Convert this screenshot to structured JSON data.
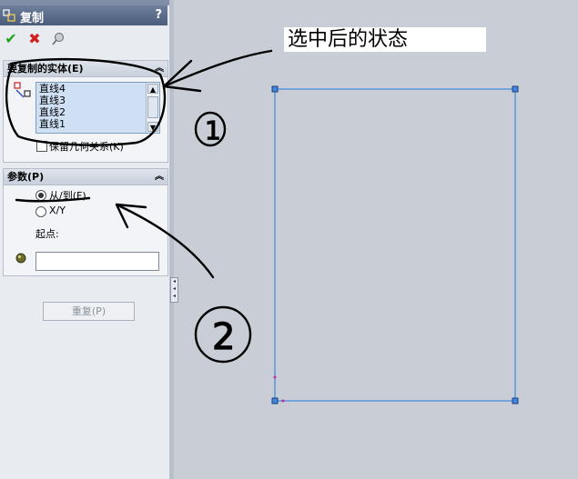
{
  "panel": {
    "title": "复制",
    "help": "?",
    "actions": {
      "ok_icon": "check-icon",
      "cancel_icon": "x-icon",
      "pushpin_icon": "pushpin-icon"
    }
  },
  "entities_group": {
    "header": "要复制的实体(E)",
    "list_items": [
      "直线4",
      "直线3",
      "直线2",
      "直线1"
    ],
    "keep_relations_label": "保留几何关系(K)",
    "keep_relations_checked": false
  },
  "params_group": {
    "header": "参数(P)",
    "options": [
      {
        "label": "从/到(F)",
        "selected": true
      },
      {
        "label": "X/Y",
        "selected": false
      }
    ],
    "start_point_label": "起点:",
    "start_point_value": ""
  },
  "repeat_button": "重复(P)",
  "annotation": {
    "note": "选中后的状态",
    "mark_1": "1",
    "mark_2": "2"
  },
  "colors": {
    "viewport_bg": "#c9cdd6",
    "sketch_line": "#3f86e0",
    "handwriting": "#000000"
  }
}
